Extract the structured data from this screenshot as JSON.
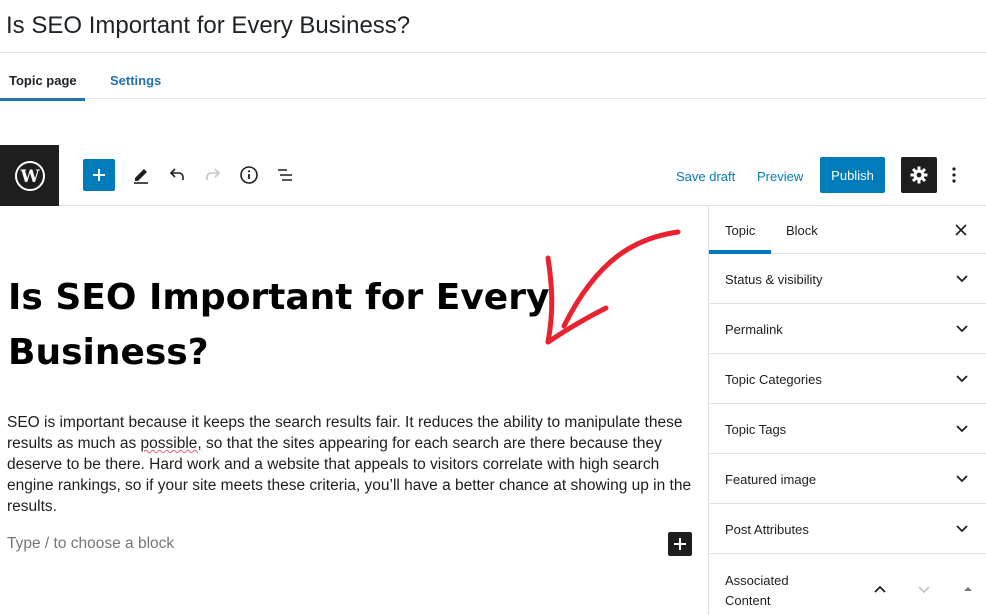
{
  "page": {
    "title": "Is SEO Important for Every Business?"
  },
  "tabs": [
    {
      "label": "Topic page",
      "active": true
    },
    {
      "label": "Settings",
      "active": false
    }
  ],
  "toolbar": {
    "logo_icon": "wordpress-icon",
    "icons": [
      "plus-icon",
      "pencil-icon",
      "undo-icon",
      "redo-icon",
      "info-icon",
      "list-view-icon"
    ],
    "save_draft_label": "Save draft",
    "preview_label": "Preview",
    "publish_label": "Publish",
    "settings_icon": "gear-icon",
    "more_icon": "more-vertical-icon",
    "accent_color": "#007cba"
  },
  "editor": {
    "post_title": "Is SEO Important for Every Business?",
    "paragraph_before": "SEO is important because it keeps the search results fair. It reduces the ability to manipulate these results as much as ",
    "paragraph_misspelled": "possible,",
    "paragraph_after": " so that the sites appearing for each search are there because they deserve to be there. Hard work and a website that appeals to visitors correlate with high search engine rankings, so if your site meets these criteria, you’ll have a better chance at showing up in the results.",
    "appender_placeholder": "Type / to choose a block",
    "annotation_color": "#e8232f"
  },
  "sidebar": {
    "tabs": [
      {
        "label": "Topic",
        "active": true
      },
      {
        "label": "Block",
        "active": false
      }
    ],
    "panels": [
      {
        "label": "Status & visibility"
      },
      {
        "label": "Permalink"
      },
      {
        "label": "Topic Categories"
      },
      {
        "label": "Topic Tags"
      },
      {
        "label": "Featured image"
      },
      {
        "label": "Post Attributes"
      }
    ],
    "associated": {
      "label": "Associated Content"
    }
  }
}
